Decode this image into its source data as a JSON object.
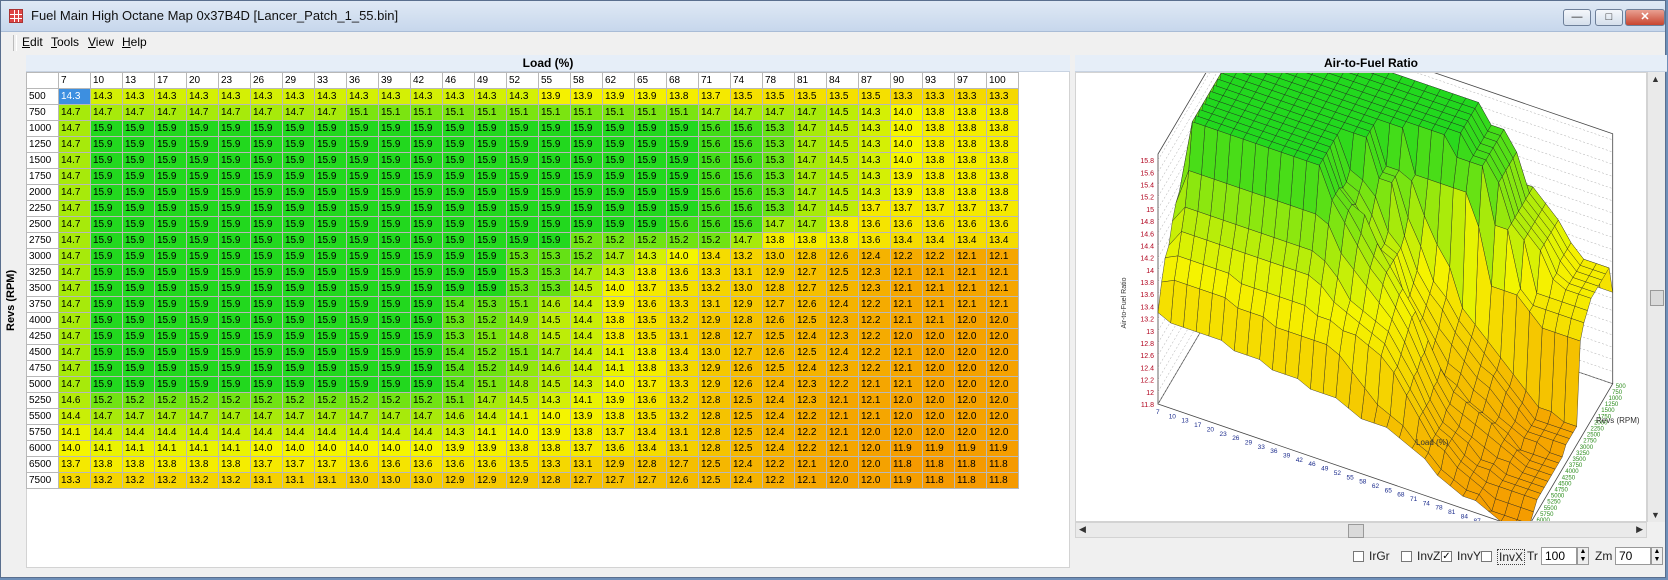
{
  "window": {
    "title": "Fuel Main High Octane Map 0x37B4D [Lancer_Patch_1_55.bin]"
  },
  "menu": [
    {
      "label": "Edit",
      "accel": "E",
      "rest": "dit"
    },
    {
      "label": "Tools",
      "accel": "T",
      "rest": "ools"
    },
    {
      "label": "View",
      "accel": "V",
      "rest": "iew"
    },
    {
      "label": "Help",
      "accel": "H",
      "rest": "elp"
    }
  ],
  "table": {
    "x_title": "Load (%)",
    "y_title": "Revs (RPM)",
    "load": [
      "7",
      "10",
      "13",
      "17",
      "20",
      "23",
      "26",
      "29",
      "33",
      "36",
      "39",
      "42",
      "46",
      "49",
      "52",
      "55",
      "58",
      "62",
      "65",
      "68",
      "71",
      "74",
      "78",
      "81",
      "84",
      "87",
      "90",
      "93",
      "97",
      "100"
    ],
    "revs": [
      "500",
      "750",
      "1000",
      "1250",
      "1500",
      "1750",
      "2000",
      "2250",
      "2500",
      "2750",
      "3000",
      "3250",
      "3500",
      "3750",
      "4000",
      "4250",
      "4500",
      "4750",
      "5000",
      "5250",
      "5500",
      "5750",
      "6000",
      "6500",
      "7500"
    ],
    "values": [
      [
        "14.3",
        "14.3",
        "14.3",
        "14.3",
        "14.3",
        "14.3",
        "14.3",
        "14.3",
        "14.3",
        "14.3",
        "14.3",
        "14.3",
        "14.3",
        "14.3",
        "14.3",
        "13.9",
        "13.9",
        "13.9",
        "13.9",
        "13.8",
        "13.7",
        "13.5",
        "13.5",
        "13.5",
        "13.5",
        "13.5",
        "13.3",
        "13.3",
        "13.3",
        "13.3"
      ],
      [
        "14.7",
        "14.7",
        "14.7",
        "14.7",
        "14.7",
        "14.7",
        "14.7",
        "14.7",
        "14.7",
        "15.1",
        "15.1",
        "15.1",
        "15.1",
        "15.1",
        "15.1",
        "15.1",
        "15.1",
        "15.1",
        "15.1",
        "15.1",
        "14.7",
        "14.7",
        "14.7",
        "14.7",
        "14.5",
        "14.3",
        "14.0",
        "13.8",
        "13.8",
        "13.8"
      ],
      [
        "14.7",
        "15.9",
        "15.9",
        "15.9",
        "15.9",
        "15.9",
        "15.9",
        "15.9",
        "15.9",
        "15.9",
        "15.9",
        "15.9",
        "15.9",
        "15.9",
        "15.9",
        "15.9",
        "15.9",
        "15.9",
        "15.9",
        "15.9",
        "15.6",
        "15.6",
        "15.3",
        "14.7",
        "14.5",
        "14.3",
        "14.0",
        "13.8",
        "13.8",
        "13.8"
      ],
      [
        "14.7",
        "15.9",
        "15.9",
        "15.9",
        "15.9",
        "15.9",
        "15.9",
        "15.9",
        "15.9",
        "15.9",
        "15.9",
        "15.9",
        "15.9",
        "15.9",
        "15.9",
        "15.9",
        "15.9",
        "15.9",
        "15.9",
        "15.9",
        "15.6",
        "15.6",
        "15.3",
        "14.7",
        "14.5",
        "14.3",
        "14.0",
        "13.8",
        "13.8",
        "13.8"
      ],
      [
        "14.7",
        "15.9",
        "15.9",
        "15.9",
        "15.9",
        "15.9",
        "15.9",
        "15.9",
        "15.9",
        "15.9",
        "15.9",
        "15.9",
        "15.9",
        "15.9",
        "15.9",
        "15.9",
        "15.9",
        "15.9",
        "15.9",
        "15.9",
        "15.6",
        "15.6",
        "15.3",
        "14.7",
        "14.5",
        "14.3",
        "14.0",
        "13.8",
        "13.8",
        "13.8"
      ],
      [
        "14.7",
        "15.9",
        "15.9",
        "15.9",
        "15.9",
        "15.9",
        "15.9",
        "15.9",
        "15.9",
        "15.9",
        "15.9",
        "15.9",
        "15.9",
        "15.9",
        "15.9",
        "15.9",
        "15.9",
        "15.9",
        "15.9",
        "15.9",
        "15.6",
        "15.6",
        "15.3",
        "14.7",
        "14.5",
        "14.3",
        "13.9",
        "13.8",
        "13.8",
        "13.8"
      ],
      [
        "14.7",
        "15.9",
        "15.9",
        "15.9",
        "15.9",
        "15.9",
        "15.9",
        "15.9",
        "15.9",
        "15.9",
        "15.9",
        "15.9",
        "15.9",
        "15.9",
        "15.9",
        "15.9",
        "15.9",
        "15.9",
        "15.9",
        "15.9",
        "15.6",
        "15.6",
        "15.3",
        "14.7",
        "14.5",
        "14.3",
        "13.9",
        "13.8",
        "13.8",
        "13.8"
      ],
      [
        "14.7",
        "15.9",
        "15.9",
        "15.9",
        "15.9",
        "15.9",
        "15.9",
        "15.9",
        "15.9",
        "15.9",
        "15.9",
        "15.9",
        "15.9",
        "15.9",
        "15.9",
        "15.9",
        "15.9",
        "15.9",
        "15.9",
        "15.9",
        "15.6",
        "15.6",
        "15.3",
        "14.7",
        "14.5",
        "13.7",
        "13.7",
        "13.7",
        "13.7",
        "13.7"
      ],
      [
        "14.7",
        "15.9",
        "15.9",
        "15.9",
        "15.9",
        "15.9",
        "15.9",
        "15.9",
        "15.9",
        "15.9",
        "15.9",
        "15.9",
        "15.9",
        "15.9",
        "15.9",
        "15.9",
        "15.9",
        "15.9",
        "15.9",
        "15.6",
        "15.6",
        "15.6",
        "14.7",
        "14.7",
        "13.8",
        "13.6",
        "13.6",
        "13.6",
        "13.6",
        "13.6"
      ],
      [
        "14.7",
        "15.9",
        "15.9",
        "15.9",
        "15.9",
        "15.9",
        "15.9",
        "15.9",
        "15.9",
        "15.9",
        "15.9",
        "15.9",
        "15.9",
        "15.9",
        "15.9",
        "15.9",
        "15.2",
        "15.2",
        "15.2",
        "15.2",
        "15.2",
        "14.7",
        "13.8",
        "13.8",
        "13.8",
        "13.6",
        "13.4",
        "13.4",
        "13.4",
        "13.4"
      ],
      [
        "14.7",
        "15.9",
        "15.9",
        "15.9",
        "15.9",
        "15.9",
        "15.9",
        "15.9",
        "15.9",
        "15.9",
        "15.9",
        "15.9",
        "15.9",
        "15.9",
        "15.3",
        "15.3",
        "15.2",
        "14.7",
        "14.3",
        "14.0",
        "13.4",
        "13.2",
        "13.0",
        "12.8",
        "12.6",
        "12.4",
        "12.2",
        "12.2",
        "12.1",
        "12.1"
      ],
      [
        "14.7",
        "15.9",
        "15.9",
        "15.9",
        "15.9",
        "15.9",
        "15.9",
        "15.9",
        "15.9",
        "15.9",
        "15.9",
        "15.9",
        "15.9",
        "15.9",
        "15.3",
        "15.3",
        "14.7",
        "14.3",
        "13.8",
        "13.6",
        "13.3",
        "13.1",
        "12.9",
        "12.7",
        "12.5",
        "12.3",
        "12.1",
        "12.1",
        "12.1",
        "12.1"
      ],
      [
        "14.7",
        "15.9",
        "15.9",
        "15.9",
        "15.9",
        "15.9",
        "15.9",
        "15.9",
        "15.9",
        "15.9",
        "15.9",
        "15.9",
        "15.9",
        "15.9",
        "15.3",
        "15.3",
        "14.5",
        "14.0",
        "13.7",
        "13.5",
        "13.2",
        "13.0",
        "12.8",
        "12.7",
        "12.5",
        "12.3",
        "12.1",
        "12.1",
        "12.1",
        "12.1"
      ],
      [
        "14.7",
        "15.9",
        "15.9",
        "15.9",
        "15.9",
        "15.9",
        "15.9",
        "15.9",
        "15.9",
        "15.9",
        "15.9",
        "15.9",
        "15.4",
        "15.3",
        "15.1",
        "14.6",
        "14.4",
        "13.9",
        "13.6",
        "13.3",
        "13.1",
        "12.9",
        "12.7",
        "12.6",
        "12.4",
        "12.2",
        "12.1",
        "12.1",
        "12.1",
        "12.1"
      ],
      [
        "14.7",
        "15.9",
        "15.9",
        "15.9",
        "15.9",
        "15.9",
        "15.9",
        "15.9",
        "15.9",
        "15.9",
        "15.9",
        "15.9",
        "15.3",
        "15.2",
        "14.9",
        "14.5",
        "14.4",
        "13.8",
        "13.5",
        "13.2",
        "12.9",
        "12.8",
        "12.6",
        "12.5",
        "12.3",
        "12.2",
        "12.1",
        "12.1",
        "12.0",
        "12.0"
      ],
      [
        "14.7",
        "15.9",
        "15.9",
        "15.9",
        "15.9",
        "15.9",
        "15.9",
        "15.9",
        "15.9",
        "15.9",
        "15.9",
        "15.9",
        "15.3",
        "15.1",
        "14.8",
        "14.5",
        "14.4",
        "13.8",
        "13.5",
        "13.1",
        "12.8",
        "12.7",
        "12.5",
        "12.4",
        "12.3",
        "12.2",
        "12.0",
        "12.0",
        "12.0",
        "12.0"
      ],
      [
        "14.7",
        "15.9",
        "15.9",
        "15.9",
        "15.9",
        "15.9",
        "15.9",
        "15.9",
        "15.9",
        "15.9",
        "15.9",
        "15.9",
        "15.4",
        "15.2",
        "15.1",
        "14.7",
        "14.4",
        "14.1",
        "13.8",
        "13.4",
        "13.0",
        "12.7",
        "12.6",
        "12.5",
        "12.4",
        "12.2",
        "12.1",
        "12.0",
        "12.0",
        "12.0"
      ],
      [
        "14.7",
        "15.9",
        "15.9",
        "15.9",
        "15.9",
        "15.9",
        "15.9",
        "15.9",
        "15.9",
        "15.9",
        "15.9",
        "15.9",
        "15.4",
        "15.2",
        "14.9",
        "14.6",
        "14.4",
        "14.1",
        "13.8",
        "13.3",
        "12.9",
        "12.6",
        "12.5",
        "12.4",
        "12.3",
        "12.2",
        "12.1",
        "12.0",
        "12.0",
        "12.0"
      ],
      [
        "14.7",
        "15.9",
        "15.9",
        "15.9",
        "15.9",
        "15.9",
        "15.9",
        "15.9",
        "15.9",
        "15.9",
        "15.9",
        "15.9",
        "15.4",
        "15.1",
        "14.8",
        "14.5",
        "14.3",
        "14.0",
        "13.7",
        "13.3",
        "12.9",
        "12.6",
        "12.4",
        "12.3",
        "12.2",
        "12.1",
        "12.1",
        "12.0",
        "12.0",
        "12.0"
      ],
      [
        "14.6",
        "15.2",
        "15.2",
        "15.2",
        "15.2",
        "15.2",
        "15.2",
        "15.2",
        "15.2",
        "15.2",
        "15.2",
        "15.2",
        "15.1",
        "14.7",
        "14.5",
        "14.3",
        "14.1",
        "13.9",
        "13.6",
        "13.2",
        "12.8",
        "12.5",
        "12.4",
        "12.3",
        "12.1",
        "12.1",
        "12.0",
        "12.0",
        "12.0",
        "12.0"
      ],
      [
        "14.4",
        "14.7",
        "14.7",
        "14.7",
        "14.7",
        "14.7",
        "14.7",
        "14.7",
        "14.7",
        "14.7",
        "14.7",
        "14.7",
        "14.6",
        "14.4",
        "14.1",
        "14.0",
        "13.9",
        "13.8",
        "13.5",
        "13.2",
        "12.8",
        "12.5",
        "12.4",
        "12.2",
        "12.1",
        "12.1",
        "12.0",
        "12.0",
        "12.0",
        "12.0"
      ],
      [
        "14.1",
        "14.4",
        "14.4",
        "14.4",
        "14.4",
        "14.4",
        "14.4",
        "14.4",
        "14.4",
        "14.4",
        "14.4",
        "14.4",
        "14.3",
        "14.1",
        "14.0",
        "13.9",
        "13.8",
        "13.7",
        "13.4",
        "13.1",
        "12.8",
        "12.5",
        "12.4",
        "12.2",
        "12.1",
        "12.0",
        "12.0",
        "12.0",
        "12.0",
        "12.0"
      ],
      [
        "14.0",
        "14.1",
        "14.1",
        "14.1",
        "14.1",
        "14.1",
        "14.0",
        "14.0",
        "14.0",
        "14.0",
        "14.0",
        "14.0",
        "13.9",
        "13.9",
        "13.8",
        "13.8",
        "13.7",
        "13.6",
        "13.4",
        "13.1",
        "12.8",
        "12.5",
        "12.4",
        "12.2",
        "12.1",
        "12.0",
        "11.9",
        "11.9",
        "11.9",
        "11.9"
      ],
      [
        "13.7",
        "13.8",
        "13.8",
        "13.8",
        "13.8",
        "13.8",
        "13.7",
        "13.7",
        "13.7",
        "13.6",
        "13.6",
        "13.6",
        "13.6",
        "13.6",
        "13.5",
        "13.3",
        "13.1",
        "12.9",
        "12.8",
        "12.7",
        "12.5",
        "12.4",
        "12.2",
        "12.1",
        "12.0",
        "12.0",
        "11.8",
        "11.8",
        "11.8",
        "11.8"
      ],
      [
        "13.3",
        "13.2",
        "13.2",
        "13.2",
        "13.2",
        "13.2",
        "13.1",
        "13.1",
        "13.1",
        "13.0",
        "13.0",
        "13.0",
        "12.9",
        "12.9",
        "12.9",
        "12.8",
        "12.7",
        "12.7",
        "12.7",
        "12.6",
        "12.5",
        "12.4",
        "12.2",
        "12.1",
        "12.0",
        "12.0",
        "11.9",
        "11.8",
        "11.8",
        "11.8"
      ]
    ]
  },
  "chart": {
    "title": "Air-to-Fuel Ratio",
    "z_label": "Air-to-Fuel Ratio",
    "x_label": "Load (%)",
    "y_label": "Revs (RPM)",
    "z_ticks": [
      "15.8",
      "15.6",
      "15.4",
      "15.2",
      "15",
      "14.8",
      "14.6",
      "14.4",
      "14.2",
      "14",
      "13.8",
      "13.6",
      "13.4",
      "13.2",
      "13",
      "12.8",
      "12.6",
      "12.4",
      "12.2",
      "12",
      "11.8"
    ],
    "z_range": [
      11.8,
      15.9
    ]
  },
  "controls": {
    "irgr": {
      "label": "IrGr",
      "checked": false
    },
    "invz": {
      "label": "InvZ",
      "checked": false
    },
    "invy": {
      "label": "InvY",
      "checked": true
    },
    "invx": {
      "label": "InvX",
      "checked": false
    },
    "tr_label": "Tr",
    "tr_value": "100",
    "zm_label": "Zm",
    "zm_value": "70"
  },
  "colors": {
    "cell_high": "#22d81e",
    "cell_mid": "#f5f500",
    "cell_low": "#f59a00",
    "selection": "#3d8fe0"
  }
}
